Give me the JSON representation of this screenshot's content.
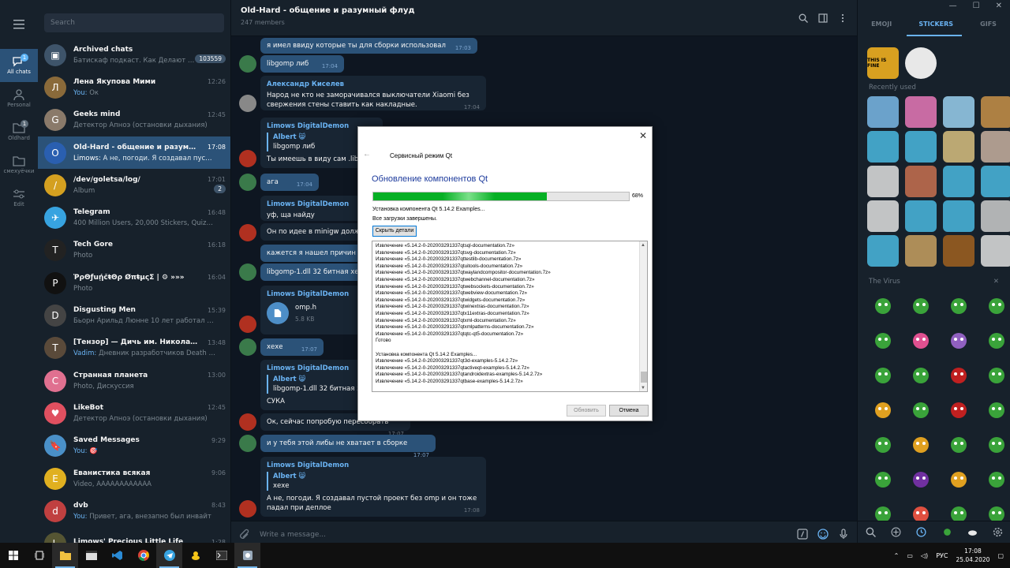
{
  "folders": [
    {
      "label": "All chats",
      "badge": "1",
      "active": true
    },
    {
      "label": "Personal",
      "badge": "",
      "active": false
    },
    {
      "label": "Oldhard",
      "badge": "1",
      "active": false
    },
    {
      "label": "смехуёчки",
      "badge": "",
      "active": false
    },
    {
      "label": "Edit",
      "badge": "",
      "active": false
    }
  ],
  "search": {
    "placeholder": "Search"
  },
  "chats": [
    {
      "name": "Archived chats",
      "preview": "Батискаф подкаст. Как Делают Иг...",
      "time": "",
      "badge": "103559",
      "you": "",
      "color": "#3e546a",
      "initial": "▣",
      "active": false
    },
    {
      "name": "Лена Якупова Мими",
      "preview": "Ок",
      "time": "12:26",
      "badge": "",
      "you": "You: ",
      "color": "#8a6a3a",
      "initial": "Л",
      "active": false
    },
    {
      "name": "Geeks mind",
      "preview": "Детектор Апноэ (остановки дыхания)",
      "time": "12:45",
      "badge": "",
      "you": "",
      "color": "#8a7a6a",
      "initial": "G",
      "active": false
    },
    {
      "name": "Old-Hard - общение и разумный ...",
      "preview": "А не, погоди. Я создавал пустой прое...",
      "time": "17:08",
      "badge": "",
      "you": "Limows: ",
      "color": "#2a5fb0",
      "initial": "O",
      "active": true
    },
    {
      "name": "/dev/goletsa/log/",
      "preview": "Album",
      "time": "17:01",
      "badge": "2",
      "you": "",
      "color": "#d4a020",
      "initial": "/",
      "active": false
    },
    {
      "name": "Telegram",
      "preview": "400 Million Users, 20,000 Stickers, Quizzes 2.0 a...",
      "time": "16:48",
      "badge": "",
      "you": "",
      "color": "#37a3e0",
      "initial": "✈",
      "active": false
    },
    {
      "name": "Tech Gore",
      "preview": "Photo",
      "time": "16:18",
      "badge": "",
      "you": "",
      "color": "#222",
      "initial": "T",
      "active": false
    },
    {
      "name": "ῬρΘƒuῄčŧΘρ ØπŧμςΣ | ⚙ »»»",
      "preview": "Photo",
      "time": "16:04",
      "badge": "",
      "you": "",
      "color": "#111",
      "initial": "P",
      "active": false
    },
    {
      "name": "Disgusting Men",
      "preview": "Бьорн Арильд Люнне 10 лет работал в Team...",
      "time": "15:39",
      "badge": "",
      "you": "",
      "color": "#444",
      "initial": "D",
      "active": false
    },
    {
      "name": "[Тензор] — Дичь им. Николаева ...",
      "preview": "Дневник разработчиков Death Strand...",
      "time": "13:48",
      "badge": "",
      "you": "Vadim: ",
      "color": "#5a4a3a",
      "initial": "Т",
      "active": false
    },
    {
      "name": "Странная планета",
      "preview": "Photo, Дискуссия",
      "time": "13:00",
      "badge": "",
      "you": "",
      "color": "#e07090",
      "initial": "С",
      "active": false
    },
    {
      "name": "LikeBot",
      "preview": "Детектор Апноэ (остановки дыхания)",
      "time": "12:45",
      "badge": "",
      "you": "",
      "color": "#e05060",
      "initial": "♥",
      "active": false
    },
    {
      "name": "Saved Messages",
      "preview": "🎯",
      "time": "9:29",
      "badge": "",
      "you": "You: ",
      "color": "#4a90c8",
      "initial": "🔖",
      "active": false
    },
    {
      "name": "Еванистика всякая",
      "preview": "Video, АААААААААААА",
      "time": "9:06",
      "badge": "",
      "you": "",
      "color": "#e0b020",
      "initial": "Е",
      "active": false
    },
    {
      "name": "dvb",
      "preview": "Привет, ага, внезапно был инвайт",
      "time": "8:43",
      "badge": "",
      "you": "You: ",
      "color": "#c04040",
      "initial": "d",
      "active": false
    },
    {
      "name": "Limows' Precious Little Life",
      "preview": "",
      "time": "1:28",
      "badge": "",
      "you": "",
      "color": "#553",
      "initial": "L",
      "active": false
    }
  ],
  "header": {
    "title": "Old-Hard - общение и разумный флуд",
    "subtitle": "247 members"
  },
  "messages": {
    "m1": {
      "text": "я имел ввиду которые ты для сборки использовал",
      "time": "17:03"
    },
    "m2": {
      "text": "libgomp либ",
      "time": "17:04"
    },
    "m3": {
      "sender": "Александр Киселев",
      "text": "Народ не кто не заморачивался выключатели Xiaomi без свержения стены ставить как накладные.",
      "time": "17:04"
    },
    "m4": {
      "sender": "Limows DigitalDemon",
      "rname": "Albert 😸",
      "rtext": "libgomp либ",
      "text": "Ты имеешь в виду сам .lib?"
    },
    "m5": {
      "text": "ага",
      "time": "17:04"
    },
    "m6": {
      "sender": "Limows DigitalDemon",
      "text": "уф, ща найду"
    },
    "m7": {
      "text": "Он по идее в minigw должен"
    },
    "m8": {
      "text": "кажется я нашел причин"
    },
    "m9": {
      "text": "libgomp-1.dll 32 битная хер"
    },
    "m10": {
      "sender": "Limows DigitalDemon",
      "fname": "omp.h",
      "fsize": "5.8 KB"
    },
    "m11": {
      "text": "хехе",
      "time": "17:07"
    },
    "m12": {
      "sender": "Limows DigitalDemon",
      "rname": "Albert 😸",
      "rtext": "libgomp-1.dll 32 битная хе",
      "text": "СУКА"
    },
    "m13": {
      "text": "Ок, сейчас попробую пересобрать",
      "time": "17:07"
    },
    "m14": {
      "text": "и у тебя этой либы не хватает в сборке",
      "time": "17:07"
    },
    "m15": {
      "sender": "Limows DigitalDemon",
      "rname": "Albert 😸",
      "rtext": "хехе",
      "text": "А не, погоди. Я создавал пустой проект без omp и он тоже падал при деплое",
      "time": "17:08"
    }
  },
  "input": {
    "placeholder": "Write a message..."
  },
  "panel": {
    "tabs": [
      "EMOJI",
      "STICKERS",
      "GIFS"
    ],
    "recent": "Recently used",
    "virus": "The Virus",
    "close": "✕",
    "topstk": "THIS IS FINE"
  },
  "dialog": {
    "title": "Сервисный режим Qt",
    "heading": "Обновление компонентов Qt",
    "progress": 68,
    "progress_text": "68%",
    "status1": "Установка компонента Qt 5.14.2 Examples...",
    "status2": "Все загрузки завершены.",
    "details": "Скрыть детали",
    "next": "Обновить",
    "cancel": "Отмена",
    "log": [
      "Извлечение «5.14.2-0-202003291337qtsql-documentation.7z»",
      "Извлечение «5.14.2-0-202003291337qtsvg-documentation.7z»",
      "Извлечение «5.14.2-0-202003291337qttestlib-documentation.7z»",
      "Извлечение «5.14.2-0-202003291337qtuitools-documentation.7z»",
      "Извлечение «5.14.2-0-202003291337qtwaylandcompositor-documentation.7z»",
      "Извлечение «5.14.2-0-202003291337qtwebchannel-documentation.7z»",
      "Извлечение «5.14.2-0-202003291337qtwebsockets-documentation.7z»",
      "Извлечение «5.14.2-0-202003291337qtwebview-documentation.7z»",
      "Извлечение «5.14.2-0-202003291337qtwidgets-documentation.7z»",
      "Извлечение «5.14.2-0-202003291337qtwinextras-documentation.7z»",
      "Извлечение «5.14.2-0-202003291337qtx11extras-documentation.7z»",
      "Извлечение «5.14.2-0-202003291337qtxml-documentation.7z»",
      "Извлечение «5.14.2-0-202003291337qtxmlpatterns-documentation.7z»",
      "Извлечение «5.14.2-0-202003291337qtqtc-qt5-documentation.7z»",
      "Готово",
      "",
      "Установка компонента Qt 5.14.2 Examples...",
      "Извлечение «5.14.2-0-202003291337qt3d-examples-5.14.2.7z»",
      "Извлечение «5.14.2-0-202003291337qtactiveqt-examples-5.14.2.7z»",
      "Извлечение «5.14.2-0-202003291337qtandroidextras-examples-5.14.2.7z»",
      "Извлечение «5.14.2-0-202003291337qtbase-examples-5.14.2.7z»"
    ]
  },
  "taskbar": {
    "lang": "РУС",
    "time": "17:08",
    "date": "25.04.2020"
  }
}
